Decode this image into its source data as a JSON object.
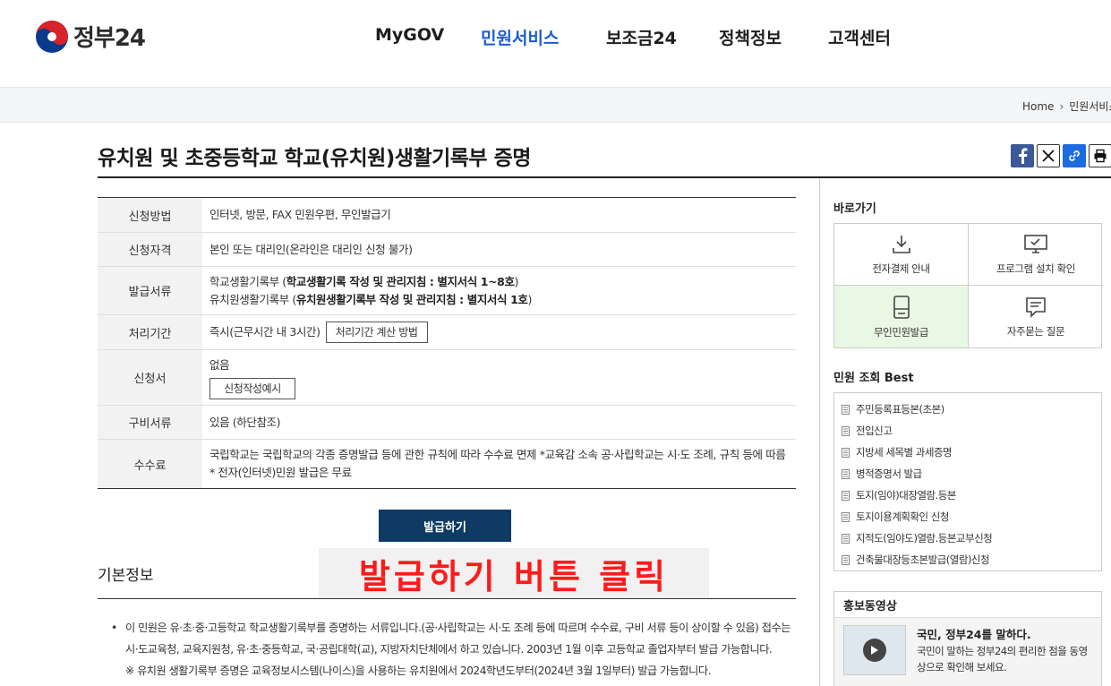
{
  "header": {
    "logo_text": "정부24",
    "nav": [
      {
        "label": "MyGOV",
        "active": false
      },
      {
        "label": "민원서비스",
        "active": true
      },
      {
        "label": "보조금24",
        "active": false
      },
      {
        "label": "정책정보",
        "active": false
      },
      {
        "label": "고객센터",
        "active": false
      }
    ]
  },
  "breadcrumb": {
    "home": "Home",
    "current": "민원서비스"
  },
  "page": {
    "title": "유치원 및 초중등학교 학교(유치원)생활기록부 증명"
  },
  "share": {
    "icons": [
      "facebook-icon",
      "x-icon",
      "link-icon",
      "print-icon"
    ]
  },
  "info": {
    "method_label": "신청방법",
    "method_value": "인터넷, 방문, FAX 민원우편, 무인발급기",
    "eligibility_label": "신청자격",
    "eligibility_value": "본인 또는 대리인(온라인은 대리인 신청 불가)",
    "documents_label": "발급서류",
    "documents_line1_prefix": "학교생활기록부 (",
    "documents_line1_bold": "학교생활기록 작성 및 관리지침 : 별지서식 1~8호",
    "documents_line1_suffix": ")",
    "documents_line2_prefix": "유치원생활기록부 (",
    "documents_line2_bold": "유치원생활기록부 작성 및 관리지침 : 별지서식 1호",
    "documents_line2_suffix": ")",
    "period_label": "처리기간",
    "period_value": "즉시(근무시간 내 3시간)",
    "period_button": "처리기간 계산 방법",
    "form_label": "신청서",
    "form_value": "없음",
    "form_button": "신청작성예시",
    "required_label": "구비서류",
    "required_value": "있음 (하단참조)",
    "fee_label": "수수료",
    "fee_value": "국립학교는 국립학교의 각종 증명발급 등에 관한 규칙에 따라 수수료 면제 *교육감 소속 공·사립학교는 시·도 조례, 규칙 등에 따름 * 전자(인터넷)민원 발급은 무료"
  },
  "issue_button": "발급하기",
  "annotation": "발급하기 버튼 클릭",
  "basic": {
    "title": "기본정보",
    "line1": "이 민원은 유·초·중·고등학교 학교생활기록부를 증명하는 서류입니다.(공·사립학교는 시·도 조례 등에 따르며 수수료, 구비 서류 등이 상이할 수 있음) 접수는 시·도교육청, 교육지원청, 유·초·중등학교, 국·공립대학(교), 지방자치단체에서 하고 있습니다. 2003년 1월 이후 고등학교 졸업자부터 발급 가능합니다.",
    "line2": "※ 유치원 생활기록부 증명은 교육정보시스템(나이스)을 사용하는 유치원에서 2024학년도부터(2024년 3월 1일부터) 발급 가능합니다."
  },
  "sidebar": {
    "quick_title": "바로가기",
    "quick": [
      {
        "label": "전자결제 안내",
        "icon": "download-icon"
      },
      {
        "label": "프로그램 설치 확인",
        "icon": "monitor-check-icon"
      },
      {
        "label": "무인민원발급",
        "icon": "kiosk-icon"
      },
      {
        "label": "자주묻는 질문",
        "icon": "chat-icon"
      }
    ],
    "best_title": "민원 조회 Best",
    "best": [
      "주민등록표등본(초본)",
      "전입신고",
      "지방세 세목별 과세증명",
      "병적증명서 발급",
      "토지(임야)대장열람.등본",
      "토지이용계획확인 신청",
      "지적도(임야도)열람.등본교부신청",
      "건축물대장등초본발급(열람)신청"
    ],
    "promo_title": "홍보동영상",
    "promo_video_title": "국민, 정부24를 말하다.",
    "promo_video_desc": "국민이 말하는 정부24의 편리한 점을 동영상으로 확인해 보세요."
  },
  "colors": {
    "accent": "#1d5cd0",
    "issue_button": "#0e3a63",
    "annotation": "#ff1a1a",
    "highlight": "#e9f8e4"
  }
}
